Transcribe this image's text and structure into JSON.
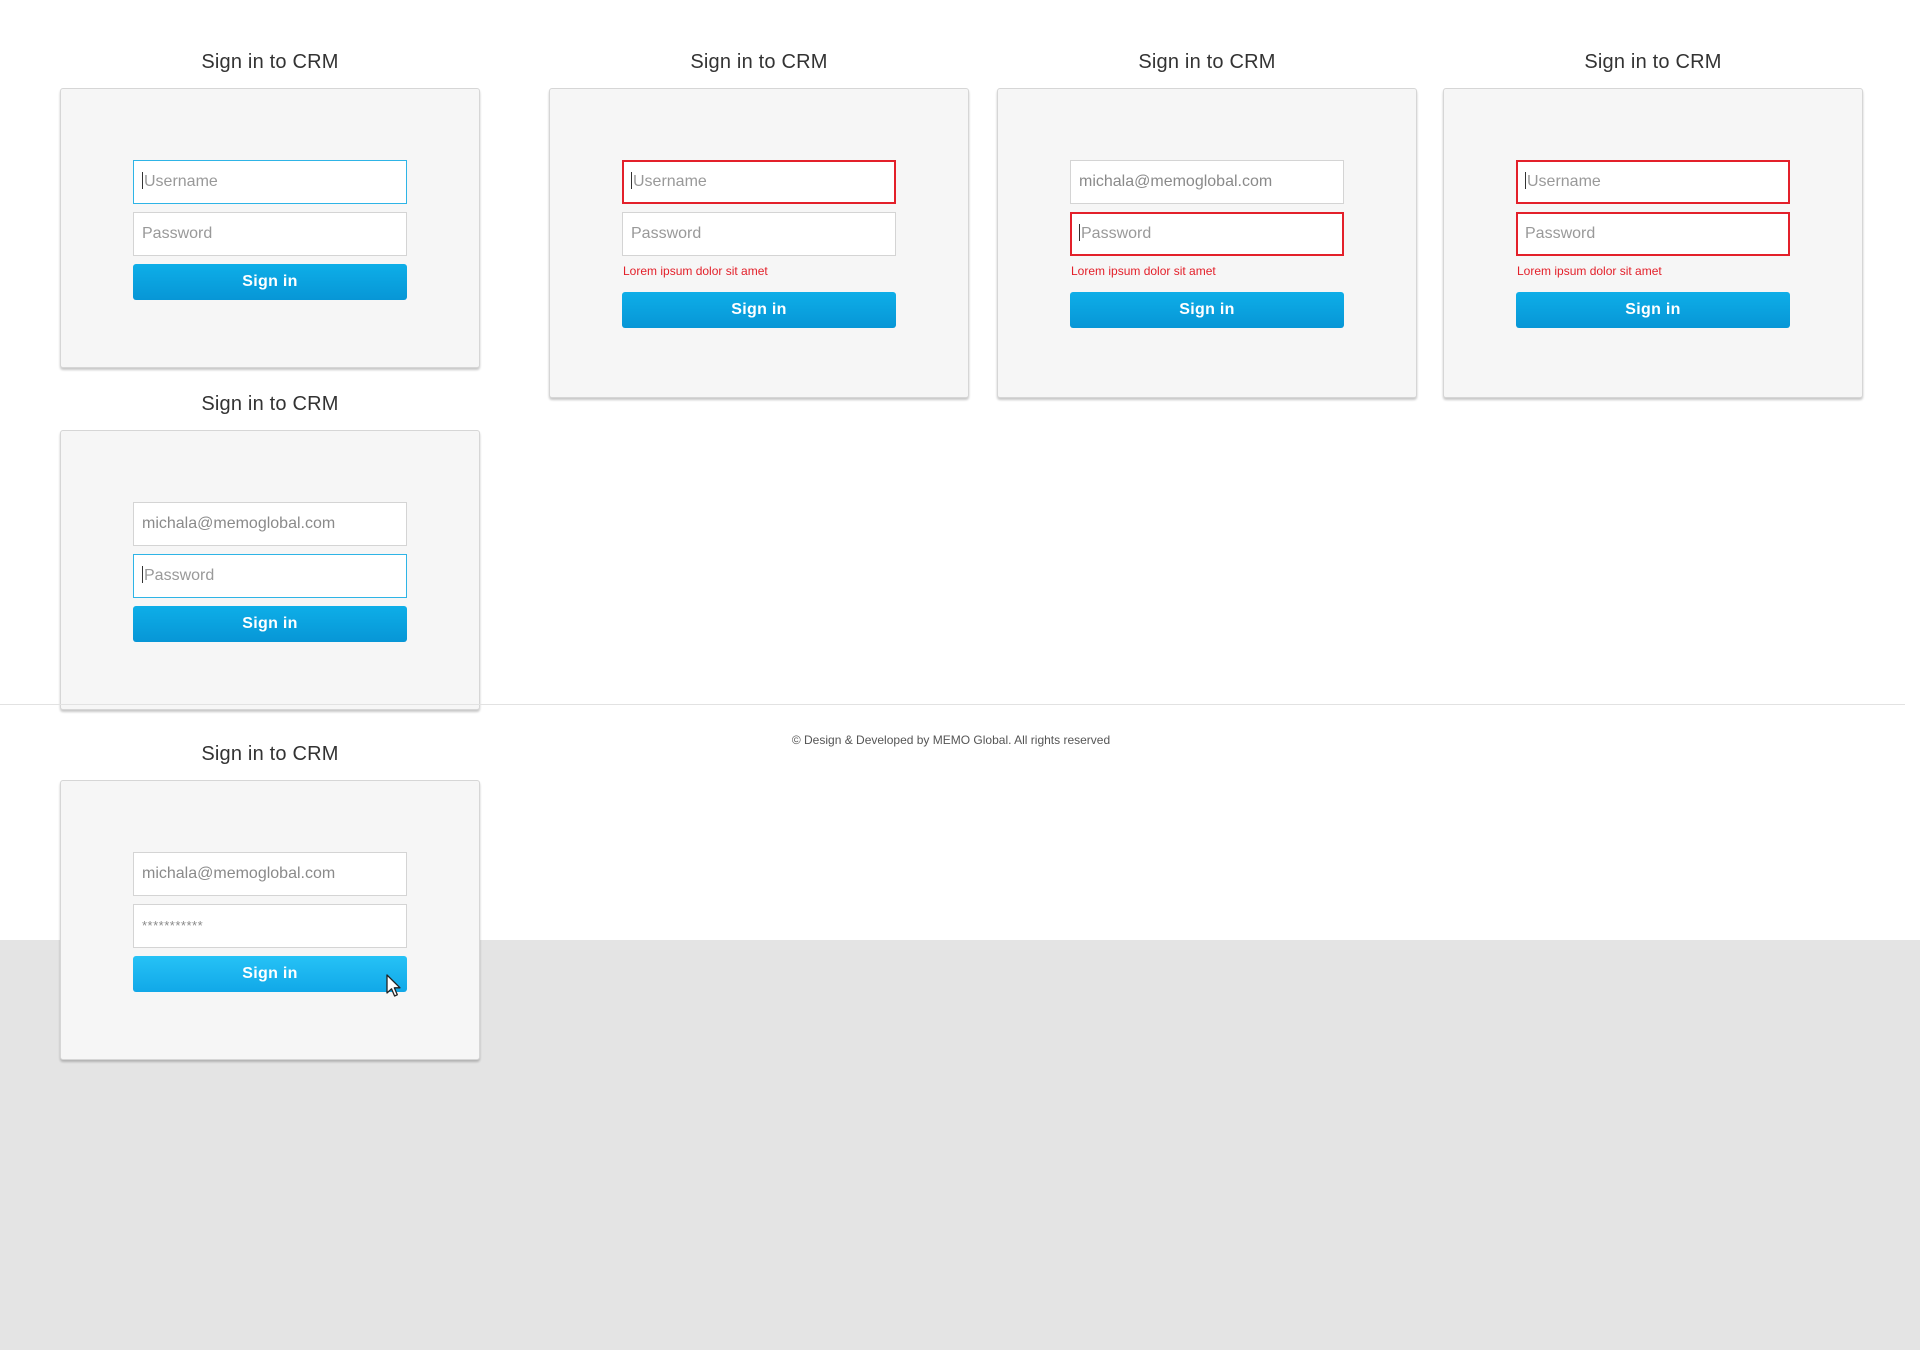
{
  "forms": [
    {
      "title": "Sign in to CRM",
      "username": {
        "placeholder": "Username",
        "value": "",
        "state": "focused"
      },
      "password": {
        "placeholder": "Password",
        "value": "",
        "state": "normal"
      },
      "error": "",
      "button": "Sign in"
    },
    {
      "title": "Sign in to CRM",
      "username": {
        "placeholder": "Username",
        "value": "",
        "state": "error"
      },
      "password": {
        "placeholder": "Password",
        "value": "",
        "state": "normal"
      },
      "error": "Lorem ipsum dolor sit amet",
      "button": "Sign in"
    },
    {
      "title": "Sign in to CRM",
      "username": {
        "placeholder": "Username",
        "value": "michala@memoglobal.com",
        "state": "normal"
      },
      "password": {
        "placeholder": "Password",
        "value": "",
        "state": "error"
      },
      "error": "Lorem ipsum dolor sit amet",
      "button": "Sign in"
    },
    {
      "title": "Sign in to CRM",
      "username": {
        "placeholder": "Username",
        "value": "",
        "state": "error"
      },
      "password": {
        "placeholder": "Password",
        "value": "",
        "state": "error"
      },
      "error": "Lorem ipsum dolor sit amet",
      "button": "Sign in"
    },
    {
      "title": "Sign in to CRM",
      "username": {
        "placeholder": "Username",
        "value": "michala@memoglobal.com",
        "state": "normal"
      },
      "password": {
        "placeholder": "Password",
        "value": "",
        "state": "focused"
      },
      "error": "",
      "button": "Sign in"
    },
    {
      "title": "Sign in to CRM",
      "username": {
        "placeholder": "Username",
        "value": "michala@memoglobal.com",
        "state": "normal"
      },
      "password": {
        "placeholder": "Password",
        "value": "***********",
        "state": "normal"
      },
      "error": "",
      "button": "Sign in",
      "button_state": "hover"
    }
  ],
  "footer": {
    "text": "© Design & Developed by MEMO Global. All rights reserved"
  },
  "colors": {
    "accent": "#0aa3e0",
    "error": "#e3202a",
    "focus": "#2eb4e6",
    "card_bg": "#f6f6f6",
    "page_bottom_bg": "#e4e4e4"
  },
  "icons": {
    "pointer": "mouse-pointer-icon"
  }
}
